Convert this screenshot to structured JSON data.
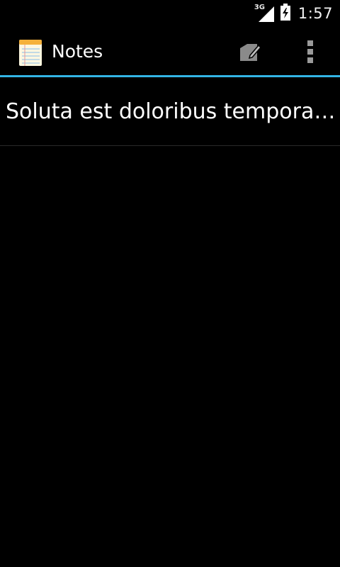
{
  "status_bar": {
    "network_type": "3G",
    "time": "1:57",
    "icons": [
      "signal-icon",
      "battery-charging-icon"
    ]
  },
  "action_bar": {
    "title": "Notes",
    "app_icon": "notepad-icon",
    "actions": [
      "new-note-icon",
      "overflow-menu-icon"
    ],
    "accent_color": "#33b5e5"
  },
  "notes": [
    {
      "title": "Soluta est doloribus tempora c…"
    }
  ]
}
